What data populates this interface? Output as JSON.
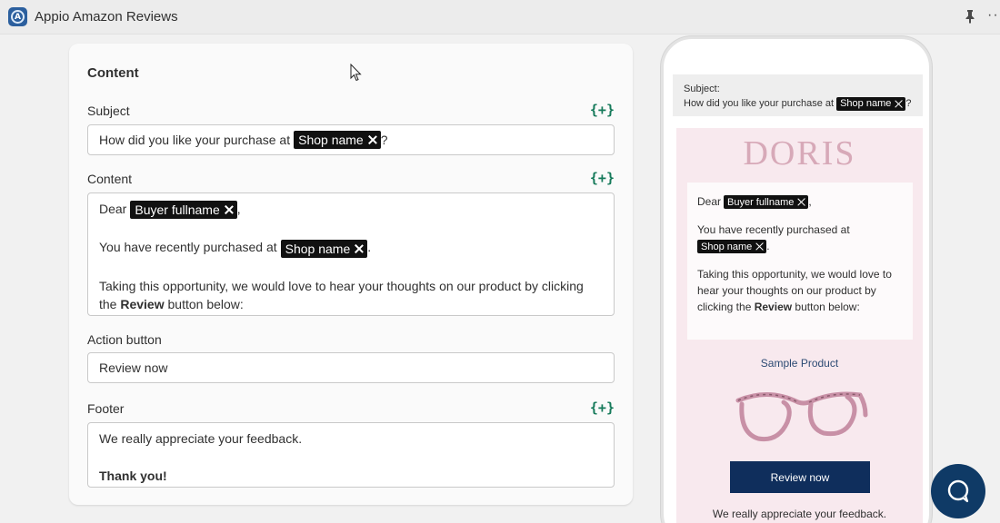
{
  "app": {
    "title": "Appio Amazon Reviews",
    "more_label": "···"
  },
  "editor": {
    "title": "Content",
    "insert_label": "{+}",
    "subject": {
      "label": "Subject",
      "text_before": "How did you like your purchase at",
      "tag": "Shop name",
      "text_after": "?"
    },
    "content": {
      "label": "Content",
      "line1_before": "Dear",
      "line1_tag": "Buyer fullname",
      "line1_after": ",",
      "line2_before": "You have recently purchased at",
      "line2_tag": "Shop name",
      "line2_after": ".",
      "line3": "Taking this opportunity, we would love to hear your thoughts on our product by clicking the",
      "line3_bold": "Review",
      "line3_end": "button below:"
    },
    "action_button": {
      "label": "Action button",
      "value": "Review now"
    },
    "footer": {
      "label": "Footer",
      "line1": "We really appreciate your feedback.",
      "line2": "Thank you!"
    }
  },
  "preview": {
    "subject_label": "Subject:",
    "subject_before": "How did you like your purchase at",
    "subject_tag": "Shop name",
    "subject_after": "?",
    "brand": "DORIS",
    "body": {
      "greet": "Dear",
      "greet_tag": "Buyer fullname",
      "greet_after": ",",
      "purchased": "You have recently purchased at",
      "purchased_tag": "Shop name",
      "purchased_after": ".",
      "opportunity": "Taking this opportunity, we would love to hear your thoughts on our product by clicking the",
      "opportunity_bold": "Review",
      "opportunity_end": "button below:"
    },
    "product_name": "Sample Product",
    "button_label": "Review now",
    "footer": "We really appreciate your feedback."
  },
  "colors": {
    "brand": "#0f2e5c",
    "insert": "#157a5a",
    "preview_bg": "#f8e9ee"
  }
}
